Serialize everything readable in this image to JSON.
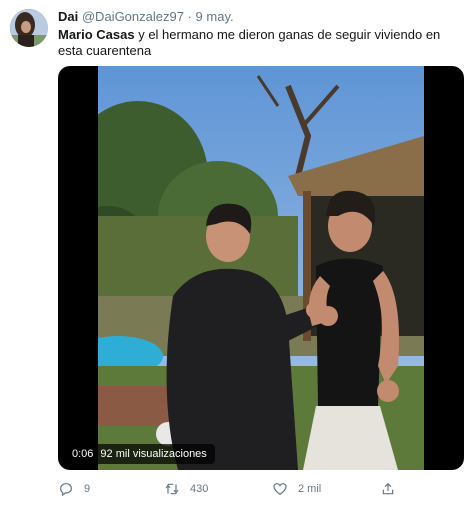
{
  "tweet": {
    "author_name": "Dai",
    "author_handle": "@DaiGonzalez97",
    "separator": "·",
    "date": "9 may.",
    "text_bold": "Mario Casas",
    "text_rest": " y el hermano me dieron ganas de seguir viviendo en esta cuarentena"
  },
  "video": {
    "time": "0:06",
    "views": "92 mil visualizaciones"
  },
  "actions": {
    "reply_count": "9",
    "retweet_count": "430",
    "like_count": "2 mil",
    "share_count": ""
  },
  "icons": {
    "reply": "reply-icon",
    "retweet": "retweet-icon",
    "like": "heart-icon",
    "share": "share-icon"
  },
  "colors": {
    "text": "#14171a",
    "secondary": "#657786",
    "video_background": "#000000"
  }
}
